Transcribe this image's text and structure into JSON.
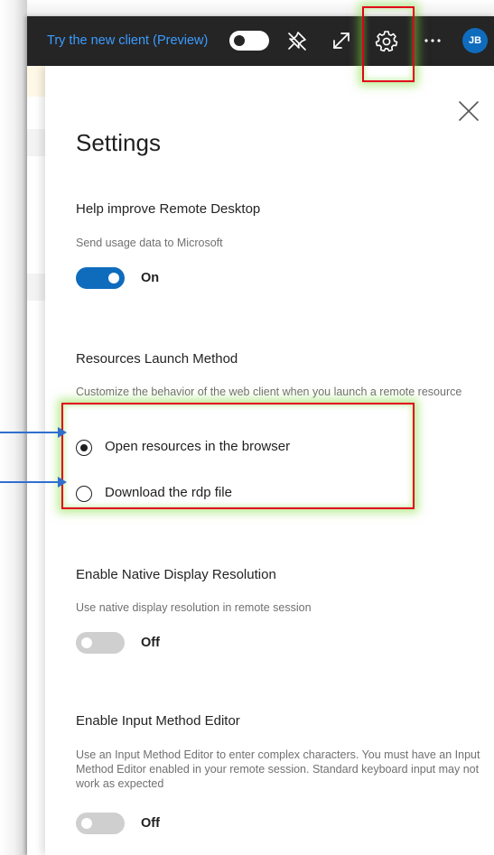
{
  "topbar": {
    "preview_link": "Try the new client (Preview)",
    "preview_toggle_on": false,
    "icons": [
      "unpin-icon",
      "fullscreen-icon",
      "gear-icon",
      "more-icon"
    ],
    "avatar_initials": "JB"
  },
  "settings": {
    "title": "Settings",
    "help_improve": {
      "title": "Help improve Remote Desktop",
      "description": "Send usage data to Microsoft",
      "state": "On"
    },
    "launch_method": {
      "title": "Resources Launch Method",
      "description": "Customize the behavior of the web client when you launch a remote resource",
      "options": [
        {
          "label": "Open resources in the browser",
          "selected": true
        },
        {
          "label": "Download the rdp file",
          "selected": false
        }
      ]
    },
    "native_resolution": {
      "title": "Enable Native Display Resolution",
      "description": "Use native display resolution in remote session",
      "state": "Off"
    },
    "ime": {
      "title": "Enable Input Method Editor",
      "description": "Use an Input Method Editor to enter complex characters. You must have an Input Method Editor enabled in your remote session. Standard keyboard input may not work as expected",
      "state": "Off"
    }
  },
  "colors": {
    "accent": "#0f6cbd",
    "topbar_bg": "#252526",
    "link": "#3b9cff",
    "highlight_border": "#e3001b",
    "highlight_glow": "#82dc3c",
    "annotation_arrow": "#2f6fd0"
  }
}
